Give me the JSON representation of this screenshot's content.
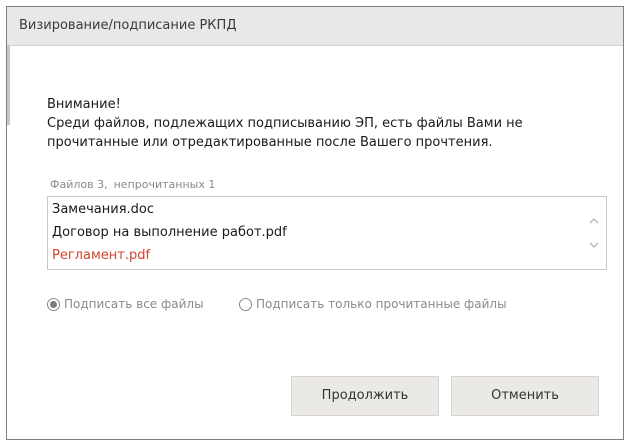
{
  "dialog": {
    "title": "Визирование/подписание РКПД"
  },
  "message": {
    "heading": "Внимание!",
    "line1": "Среди файлов, подлежащих подписыванию ЭП, есть файлы Вами не",
    "line2": "прочитанные или отредактированные после Вашего прочтения."
  },
  "counts": {
    "files": "Файлов 3,",
    "unread": "непрочитанных 1"
  },
  "files": [
    {
      "name": "Замечания.doc",
      "unread": false
    },
    {
      "name": "Договор на выполнение работ.pdf",
      "unread": false
    },
    {
      "name": "Регламент.pdf",
      "unread": true
    }
  ],
  "options": {
    "sign_all": "Подписать все файлы",
    "sign_read_only": "Подписать только прочитанные файлы",
    "selected": "sign_all"
  },
  "buttons": {
    "continue": "Продолжить",
    "cancel": "Отменить"
  },
  "colors": {
    "unread_file": "#d0442c",
    "button_bg": "#ebe9e6",
    "titlebar_bg": "#e8e8e8"
  },
  "icons": {
    "scroll_up": "chevron-up-icon",
    "scroll_down": "chevron-down-icon"
  }
}
